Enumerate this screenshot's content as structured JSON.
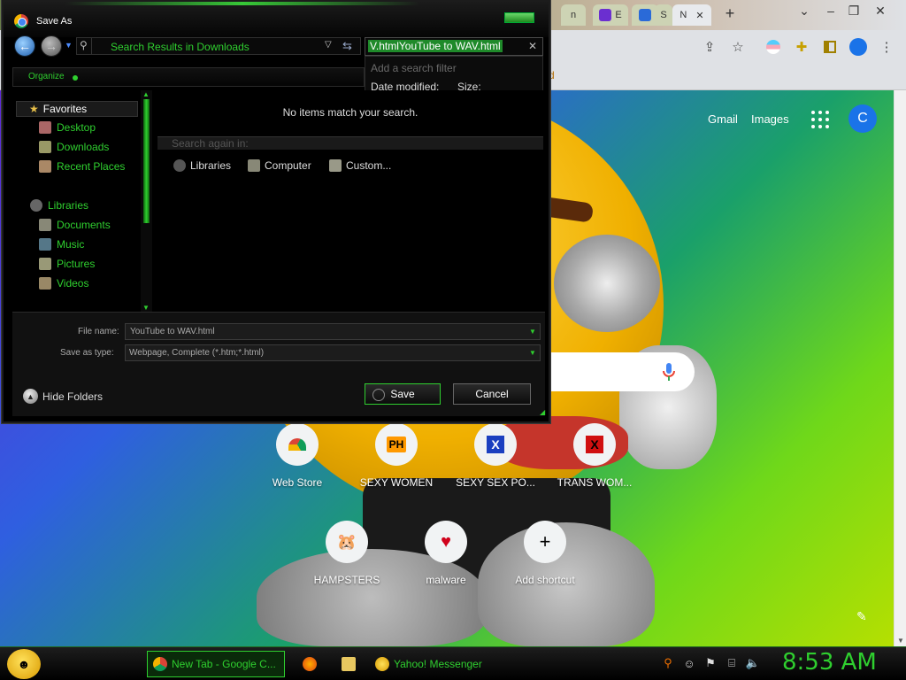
{
  "chrome": {
    "tabs": [
      {
        "label": "n"
      },
      {
        "label": "E"
      },
      {
        "label": ""
      },
      {
        "label": "S"
      },
      {
        "label": "N"
      }
    ],
    "new_tab": "+",
    "bookmark_partial": "d",
    "ntp": {
      "gmail": "Gmail",
      "images": "Images",
      "avatar_letter": "C",
      "shortcuts": [
        {
          "label": "Web Store",
          "glyph": ""
        },
        {
          "label": "SEXY WOMEN",
          "glyph": "PH"
        },
        {
          "label": "SEXY SEX PO...",
          "glyph": "X"
        },
        {
          "label": "TRANS WOM...",
          "glyph": "X"
        },
        {
          "label": "HAMPSTERS",
          "glyph": "🐹"
        },
        {
          "label": "malware",
          "glyph": "♥"
        },
        {
          "label": "Add shortcut",
          "glyph": "+"
        }
      ]
    }
  },
  "dialog": {
    "title": "Save As",
    "address": "Search Results in Downloads",
    "search_value": "V.htmlYouTube to WAV.html",
    "search_dropdown": {
      "add_filter": "Add a search filter",
      "date_modified": "Date modified:",
      "size": "Size:"
    },
    "organize": "Organize",
    "nav": {
      "favorites": "Favorites",
      "desktop": "Desktop",
      "downloads": "Downloads",
      "recent": "Recent Places",
      "libraries": "Libraries",
      "documents": "Documents",
      "music": "Music",
      "pictures": "Pictures",
      "videos": "Videos"
    },
    "no_items": "No items match your search.",
    "search_again": "Search again in:",
    "search_locations": [
      "Libraries",
      "Computer",
      "Custom..."
    ],
    "file_name_label": "File name:",
    "file_name_value": "YouTube to WAV.html",
    "save_type_label": "Save as type:",
    "save_type_value": "Webpage, Complete (*.htm;*.html)",
    "hide_folders": "Hide Folders",
    "save": "Save",
    "cancel": "Cancel"
  },
  "taskbar": {
    "tasks": [
      {
        "label": "New Tab - Google C..."
      },
      {
        "label": "Yahoo! Messenger"
      }
    ],
    "clock": "8:53 AM"
  },
  "colors": {
    "accent_green": "#2fcf2f",
    "chrome_blue": "#1a73e8"
  }
}
